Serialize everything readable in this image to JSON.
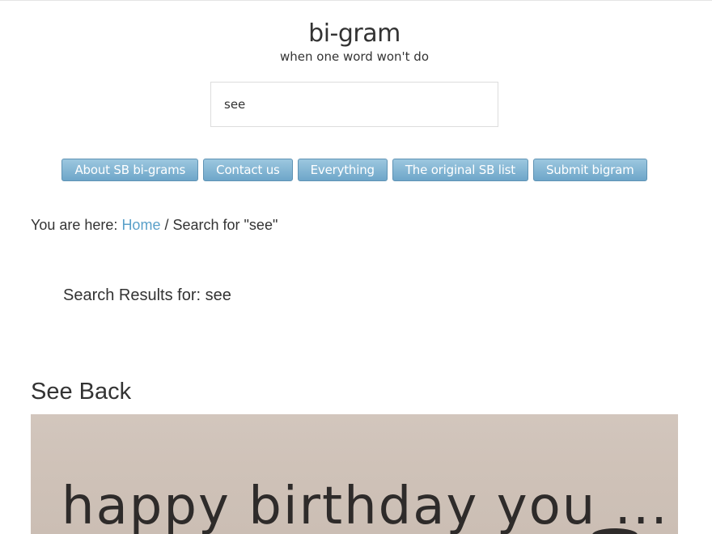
{
  "site": {
    "title": "bi-gram",
    "tagline": "when one word won't do"
  },
  "search": {
    "value": "see"
  },
  "nav": {
    "items": [
      {
        "label": "About SB bi-grams"
      },
      {
        "label": "Contact us"
      },
      {
        "label": "Everything"
      },
      {
        "label": "The original SB list"
      },
      {
        "label": "Submit bigram"
      }
    ]
  },
  "breadcrumb": {
    "prefix": "You are here:",
    "home_label": "Home",
    "separator": "/",
    "current": "Search for \"see\""
  },
  "results": {
    "heading": "Search Results for: see"
  },
  "entry": {
    "title": "See Back",
    "image_text": "happy birthday you ..."
  },
  "colors": {
    "nav_button": "#7db3d3",
    "link": "#5aa0c9",
    "text": "#333333"
  }
}
